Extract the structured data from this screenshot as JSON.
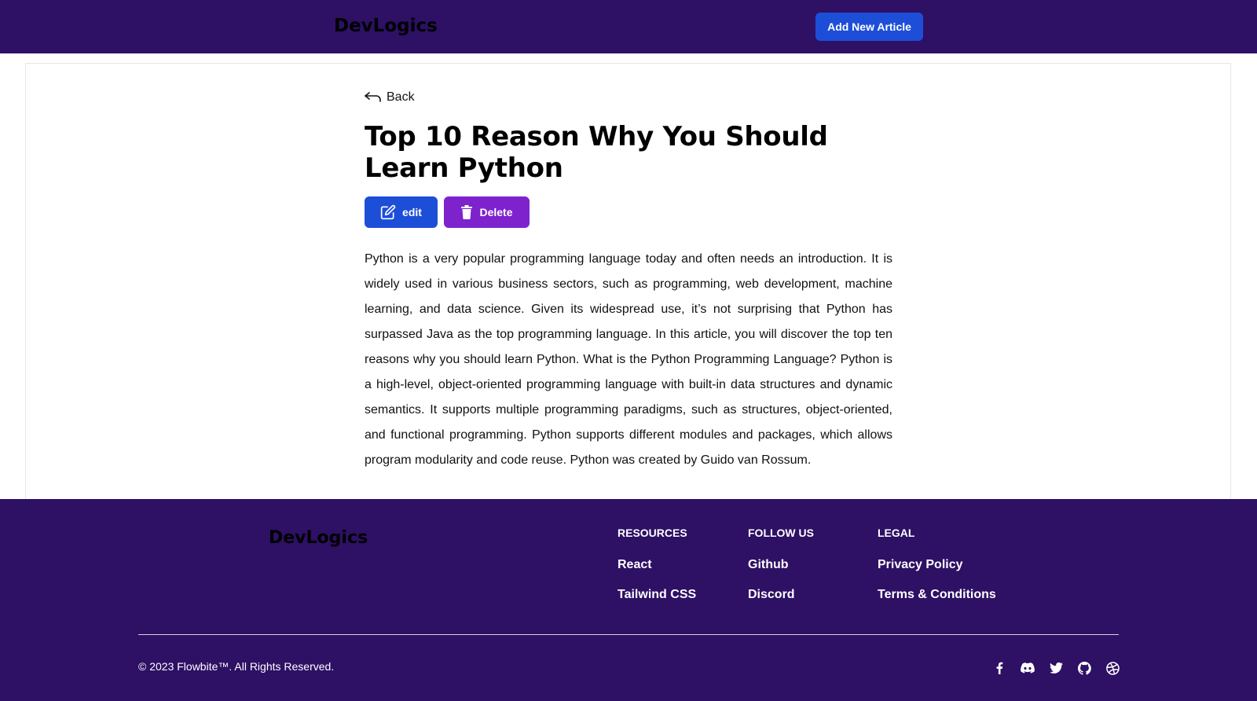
{
  "header": {
    "brand": "DevLogics",
    "add_button": "Add New Article"
  },
  "article": {
    "back_label": "Back",
    "title": "Top 10 Reason Why You Should Learn Python",
    "edit_label": "edit",
    "delete_label": "Delete",
    "body": "Python is a very popular programming language today and often needs an introduction. It is widely used in various business sectors, such as programming, web development, machine learning, and data science. Given its widespread use, it’s not surprising that Python has surpassed Java as the top programming language. In this article, you will discover the top ten reasons why you should learn Python. What is the Python Programming Language? Python is a high-level, object-oriented programming language with built-in data structures and dynamic semantics. It supports multiple programming paradigms, such as structures, object-oriented, and functional programming. Python supports different modules and packages, which allows program modularity and code reuse. Python was created by Guido van Rossum."
  },
  "footer": {
    "brand": "DevLogics",
    "columns": [
      {
        "heading": "Resources",
        "links": [
          "React",
          "Tailwind CSS"
        ]
      },
      {
        "heading": "Follow us",
        "links": [
          "Github",
          "Discord"
        ]
      },
      {
        "heading": "Legal",
        "links": [
          "Privacy Policy",
          "Terms & Conditions"
        ]
      }
    ],
    "copyright": "© 2023 Flowbite™. All Rights Reserved.",
    "social_icons": [
      "facebook-icon",
      "discord-icon",
      "twitter-icon",
      "github-icon",
      "dribbble-icon"
    ]
  },
  "colors": {
    "nav_background": "#2e1065",
    "primary_button": "#1d4ed8",
    "delete_button": "#7e22ce"
  }
}
